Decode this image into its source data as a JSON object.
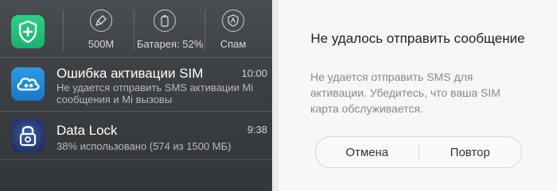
{
  "quick_toggles": {
    "shield_icon": "shield-plus-icon",
    "items": [
      {
        "icon": "cleaner-brush-icon",
        "label": "500M"
      },
      {
        "icon": "battery-icon",
        "label": "Батарея: 52%"
      },
      {
        "icon": "spam-shield-icon",
        "label": "Спам"
      }
    ]
  },
  "notifications": [
    {
      "icon": "cloud-icon",
      "title": "Ошибка активации SIM",
      "time": "10:00",
      "body": "Не удается отправить SMS активации Mi сообщения и Mi вызовы"
    },
    {
      "icon": "data-lock-icon",
      "title": "Data Lock",
      "time": "9:38",
      "body": "38% использовано (574 из 1500 МБ)"
    }
  ],
  "dialog": {
    "title": "Не удалось отправить сообщение",
    "message": "Не удается отправить SMS для активации. Убедитесь, что ваша SIM карта обслуживается.",
    "cancel_label": "Отмена",
    "retry_label": "Повтор"
  },
  "colors": {
    "shield_green": "#22c07a",
    "cloud_blue": "#1c8ad8",
    "lock_dark": "#2a3f7a"
  }
}
